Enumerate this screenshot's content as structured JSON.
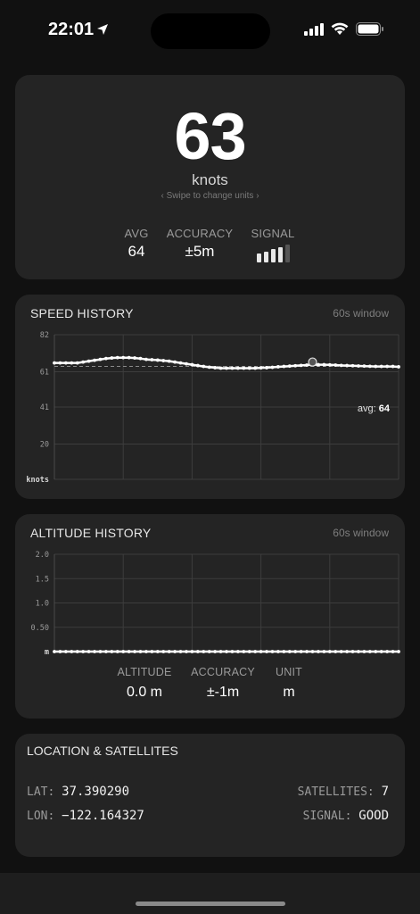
{
  "status_bar": {
    "time": "22:01"
  },
  "speed": {
    "value": "63",
    "unit": "knots",
    "swipe_hint": "‹  Swipe to change units  ›",
    "avg_label": "AVG",
    "avg_value": "64",
    "accuracy_label": "ACCURACY",
    "accuracy_value": "±5m",
    "signal_label": "SIGNAL",
    "signal_level": 4,
    "signal_max": 5
  },
  "speed_history": {
    "title": "SPEED HISTORY",
    "window": "60s window",
    "avg_label": "avg:",
    "avg_value": "64"
  },
  "altitude_history": {
    "title": "ALTITUDE HISTORY",
    "window": "60s window",
    "altitude_label": "ALTITUDE",
    "altitude_value": "0.0 m",
    "accuracy_label": "ACCURACY",
    "accuracy_value": "±-1m",
    "unit_label": "UNIT",
    "unit_value": "m"
  },
  "location": {
    "title": "LOCATION & SATELLITES",
    "lat_label": "LAT:",
    "lat_value": "37.390290",
    "lon_label": "LON:",
    "lon_value": "−122.164327",
    "sats_label": "SATELLITES:",
    "sats_value": "7",
    "signal_label": "SIGNAL:",
    "signal_value": "GOOD"
  },
  "chart_data": [
    {
      "type": "line",
      "title": "SPEED HISTORY",
      "ylabel": "knots",
      "y_ticks": [
        "82",
        "61",
        "41",
        "20"
      ],
      "ylim": [
        0,
        82
      ],
      "x": [
        0,
        1,
        2,
        3,
        4,
        5,
        6,
        7,
        8,
        9,
        10,
        11,
        12,
        13,
        14,
        15,
        16,
        17,
        18,
        19,
        20,
        21,
        22,
        23,
        24,
        25,
        26,
        27,
        28,
        29,
        30,
        31,
        32,
        33,
        34,
        35,
        36,
        37,
        38,
        39,
        40,
        41,
        42,
        43,
        44,
        45,
        46,
        47,
        48,
        49,
        50,
        51,
        52,
        53,
        54,
        55,
        56,
        57,
        58,
        59,
        60
      ],
      "series": [
        {
          "values": [
            66,
            66,
            66,
            66,
            66,
            66.5,
            67,
            67.5,
            68,
            68.5,
            68.8,
            69,
            69,
            69,
            68.8,
            68.5,
            68,
            67.8,
            67.6,
            67.3,
            67,
            66.5,
            66,
            65.5,
            65,
            64.5,
            64,
            63.6,
            63.3,
            63,
            63,
            63,
            63,
            63,
            63,
            63,
            63.2,
            63.3,
            63.5,
            63.8,
            64,
            64.2,
            64.4,
            64.6,
            64.8,
            65,
            65,
            65,
            64.9,
            64.8,
            64.6,
            64.5,
            64.4,
            64.3,
            64.2,
            64.1,
            64,
            64,
            64,
            64,
            63.8
          ]
        }
      ],
      "avg": 64,
      "marker_index": 45,
      "grid": true
    },
    {
      "type": "line",
      "title": "ALTITUDE HISTORY",
      "ylabel": "m",
      "y_ticks": [
        "2.0",
        "1.5",
        "1.0",
        "0.50"
      ],
      "ylim": [
        0,
        2.0
      ],
      "x": [
        0,
        1,
        2,
        3,
        4,
        5,
        6,
        7,
        8,
        9,
        10,
        11,
        12,
        13,
        14,
        15,
        16,
        17,
        18,
        19,
        20,
        21,
        22,
        23,
        24,
        25,
        26,
        27,
        28,
        29,
        30,
        31,
        32,
        33,
        34,
        35,
        36,
        37,
        38,
        39,
        40,
        41,
        42,
        43,
        44,
        45,
        46,
        47,
        48,
        49,
        50,
        51,
        52,
        53,
        54,
        55,
        56,
        57,
        58,
        59,
        60
      ],
      "series": [
        {
          "values": [
            0,
            0,
            0,
            0,
            0,
            0,
            0,
            0,
            0,
            0,
            0,
            0,
            0,
            0,
            0,
            0,
            0,
            0,
            0,
            0,
            0,
            0,
            0,
            0,
            0,
            0,
            0,
            0,
            0,
            0,
            0,
            0,
            0,
            0,
            0,
            0,
            0,
            0,
            0,
            0,
            0,
            0,
            0,
            0,
            0,
            0,
            0,
            0,
            0,
            0,
            0,
            0,
            0,
            0,
            0,
            0,
            0,
            0,
            0,
            0,
            0
          ]
        }
      ],
      "grid": true
    }
  ]
}
